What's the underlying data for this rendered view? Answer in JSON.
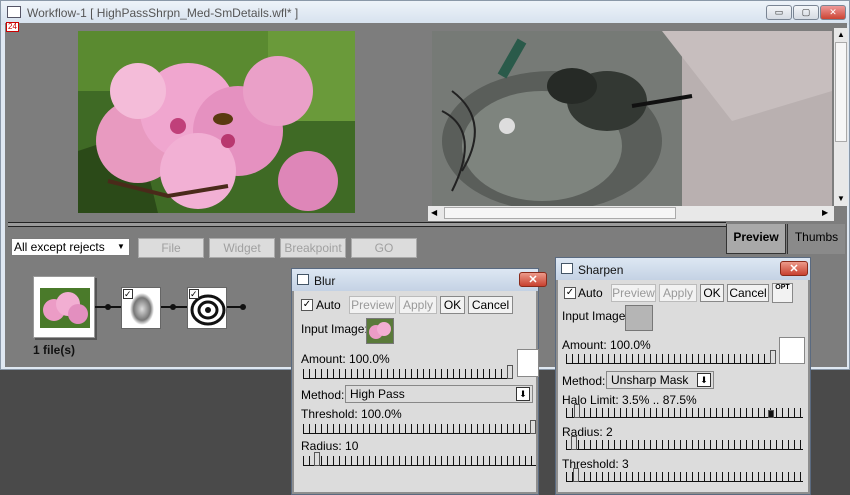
{
  "window": {
    "title": "Workflow-1 [ HighPassShrpn_Med-SmDetails.wfl* ]",
    "tag": "24",
    "min_label": "▭",
    "max_label": "▢",
    "close_label": "✕"
  },
  "tabs": {
    "preview": "Preview",
    "thumbs": "Thumbs"
  },
  "toolbar": {
    "filter_value": "All except rejects",
    "file": "File",
    "widget": "Widget",
    "breakpoint": "Breakpoint",
    "go": "GO"
  },
  "workflow": {
    "file_count": "1 file(s)"
  },
  "blur": {
    "title": "Blur",
    "auto": "Auto",
    "preview": "Preview",
    "apply": "Apply",
    "ok": "OK",
    "cancel": "Cancel",
    "input_image": "Input Image:",
    "amount": "Amount: 100.0%",
    "method_label": "Method:",
    "method_value": "High Pass",
    "threshold": "Threshold: 100.0%",
    "radius": "Radius: 10",
    "amount_level": 1.0,
    "threshold_level": 1.0,
    "radius_level": 0.05
  },
  "sharpen": {
    "title": "Sharpen",
    "auto": "Auto",
    "preview": "Preview",
    "apply": "Apply",
    "ok": "OK",
    "cancel": "Cancel",
    "opt": "OPT",
    "input_image": "Input Image:",
    "amount": "Amount: 100.0%",
    "method_label": "Method:",
    "method_value": "Unsharp Mask",
    "halo": "Halo Limit: 3.5% .. 87.5%",
    "radius": "Radius: 2",
    "threshold": "Threshold: 3",
    "amount_level": 1.0,
    "halo_low": 0.035,
    "halo_high": 0.875,
    "radius_level": 0.02,
    "threshold_level": 0.03
  }
}
